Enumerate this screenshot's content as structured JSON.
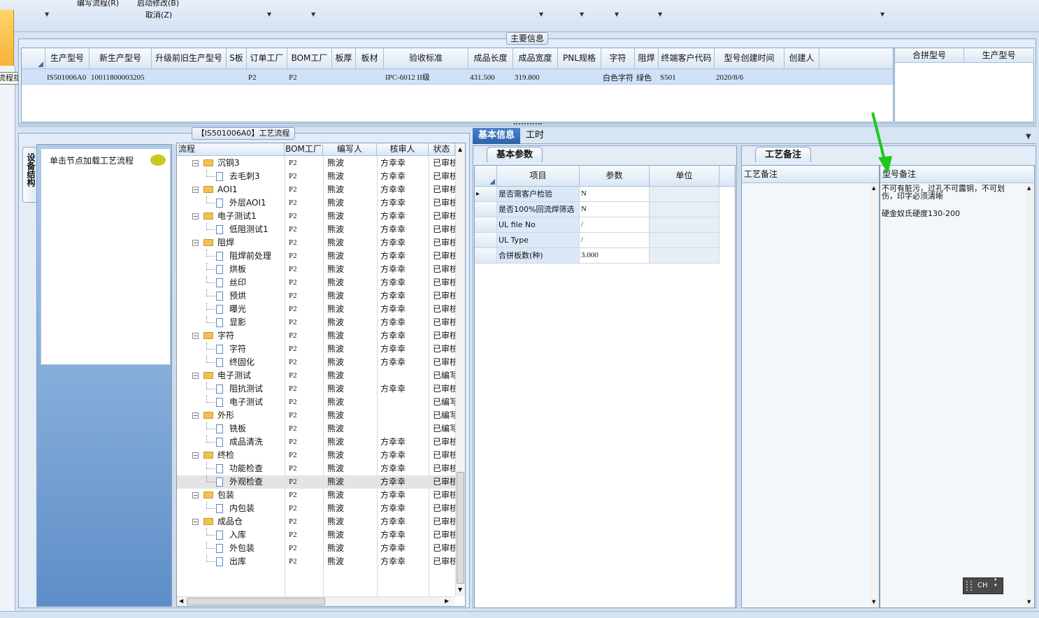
{
  "menu": {
    "item1": "编写流程(R)",
    "item2": "启动修改(B)",
    "item3": "取消(Z)"
  },
  "left_tooltip": "流程指示",
  "main_info": {
    "title": "主要信息",
    "columns": [
      "生产型号",
      "新生产型号",
      "升级前旧生产型号",
      "S板",
      "订单工厂",
      "BOM工厂",
      "板厚",
      "板材",
      "验收标准",
      "成品长度",
      "成品宽度",
      "PNL规格",
      "字符",
      "阻焊",
      "终端客户代码",
      "型号创建时间",
      "创建人"
    ],
    "row": [
      "IS501006A0",
      "10011800003205",
      "",
      "",
      "P2",
      "P2",
      "",
      "",
      "IPC-6012 II级",
      "431.500",
      "319.800",
      "",
      "白色字符",
      "绿色",
      "S501",
      "2020/8/6",
      ""
    ],
    "side_columns": [
      "合拼型号",
      "生产型号"
    ]
  },
  "side_tab": "设备结构",
  "node_hint": "单击节点加载工艺流程",
  "process": {
    "title": "【IS501006A0】工艺流程",
    "columns": [
      "流程",
      "BOM工厂",
      "编写人",
      "核审人",
      "状态"
    ],
    "rows": [
      {
        "level": 0,
        "type": "folder",
        "name": "沉铜3",
        "bom": "P2",
        "writer": "熊波",
        "reviewer": "方幸幸",
        "status": "已审核"
      },
      {
        "level": 1,
        "type": "doc",
        "name": "去毛刺3",
        "bom": "P2",
        "writer": "熊波",
        "reviewer": "方幸幸",
        "status": "已审核"
      },
      {
        "level": 0,
        "type": "folder",
        "name": "AOI1",
        "bom": "P2",
        "writer": "熊波",
        "reviewer": "方幸幸",
        "status": "已审核"
      },
      {
        "level": 1,
        "type": "doc",
        "name": "外层AOI1",
        "bom": "P2",
        "writer": "熊波",
        "reviewer": "方幸幸",
        "status": "已审核"
      },
      {
        "level": 0,
        "type": "folder",
        "name": "电子测试1",
        "bom": "P2",
        "writer": "熊波",
        "reviewer": "方幸幸",
        "status": "已审核"
      },
      {
        "level": 1,
        "type": "doc",
        "name": "低阻测试1",
        "bom": "P2",
        "writer": "熊波",
        "reviewer": "方幸幸",
        "status": "已审核"
      },
      {
        "level": 0,
        "type": "folder",
        "name": "阻焊",
        "bom": "P2",
        "writer": "熊波",
        "reviewer": "方幸幸",
        "status": "已审核"
      },
      {
        "level": 1,
        "type": "doc",
        "name": "阻焊前处理",
        "bom": "P2",
        "writer": "熊波",
        "reviewer": "方幸幸",
        "status": "已审核"
      },
      {
        "level": 1,
        "type": "doc",
        "name": "烘板",
        "bom": "P2",
        "writer": "熊波",
        "reviewer": "方幸幸",
        "status": "已审核"
      },
      {
        "level": 1,
        "type": "doc",
        "name": "丝印",
        "bom": "P2",
        "writer": "熊波",
        "reviewer": "方幸幸",
        "status": "已审核"
      },
      {
        "level": 1,
        "type": "doc",
        "name": "预烘",
        "bom": "P2",
        "writer": "熊波",
        "reviewer": "方幸幸",
        "status": "已审核"
      },
      {
        "level": 1,
        "type": "doc",
        "name": "曝光",
        "bom": "P2",
        "writer": "熊波",
        "reviewer": "方幸幸",
        "status": "已审核"
      },
      {
        "level": 1,
        "type": "doc",
        "name": "显影",
        "bom": "P2",
        "writer": "熊波",
        "reviewer": "方幸幸",
        "status": "已审核"
      },
      {
        "level": 0,
        "type": "folder",
        "name": "字符",
        "bom": "P2",
        "writer": "熊波",
        "reviewer": "方幸幸",
        "status": "已审核"
      },
      {
        "level": 1,
        "type": "doc",
        "name": "字符",
        "bom": "P2",
        "writer": "熊波",
        "reviewer": "方幸幸",
        "status": "已审核"
      },
      {
        "level": 1,
        "type": "doc",
        "name": "终固化",
        "bom": "P2",
        "writer": "熊波",
        "reviewer": "方幸幸",
        "status": "已审核"
      },
      {
        "level": 0,
        "type": "folder",
        "name": "电子测试",
        "bom": "P2",
        "writer": "熊波",
        "reviewer": "",
        "status": "已编写"
      },
      {
        "level": 1,
        "type": "doc",
        "name": "阻抗测试",
        "bom": "P2",
        "writer": "熊波",
        "reviewer": "方幸幸",
        "status": "已审核"
      },
      {
        "level": 1,
        "type": "doc",
        "name": "电子测试",
        "bom": "P2",
        "writer": "熊波",
        "reviewer": "",
        "status": "已编写"
      },
      {
        "level": 0,
        "type": "folder",
        "name": "外形",
        "bom": "P2",
        "writer": "熊波",
        "reviewer": "",
        "status": "已编写"
      },
      {
        "level": 1,
        "type": "doc",
        "name": "铣板",
        "bom": "P2",
        "writer": "熊波",
        "reviewer": "",
        "status": "已编写"
      },
      {
        "level": 1,
        "type": "doc",
        "name": "成品清洗",
        "bom": "P2",
        "writer": "熊波",
        "reviewer": "方幸幸",
        "status": "已审核"
      },
      {
        "level": 0,
        "type": "folder",
        "name": "终检",
        "bom": "P2",
        "writer": "熊波",
        "reviewer": "方幸幸",
        "status": "已审核"
      },
      {
        "level": 1,
        "type": "doc",
        "name": "功能检查",
        "bom": "P2",
        "writer": "熊波",
        "reviewer": "方幸幸",
        "status": "已审核"
      },
      {
        "level": 1,
        "type": "doc",
        "name": "外观检查",
        "bom": "P2",
        "writer": "熊波",
        "reviewer": "方幸幸",
        "status": "已审核"
      },
      {
        "level": 0,
        "type": "folder",
        "name": "包装",
        "bom": "P2",
        "writer": "熊波",
        "reviewer": "方幸幸",
        "status": "已审核"
      },
      {
        "level": 1,
        "type": "doc",
        "name": "内包装",
        "bom": "P2",
        "writer": "熊波",
        "reviewer": "方幸幸",
        "status": "已审核"
      },
      {
        "level": 0,
        "type": "folder",
        "name": "成品仓",
        "bom": "P2",
        "writer": "熊波",
        "reviewer": "方幸幸",
        "status": "已审核"
      },
      {
        "level": 1,
        "type": "doc",
        "name": "入库",
        "bom": "P2",
        "writer": "熊波",
        "reviewer": "方幸幸",
        "status": "已审核"
      },
      {
        "level": 1,
        "type": "doc",
        "name": "外包装",
        "bom": "P2",
        "writer": "熊波",
        "reviewer": "方幸幸",
        "status": "已审核"
      },
      {
        "level": 1,
        "type": "doc",
        "name": "出库",
        "bom": "P2",
        "writer": "熊波",
        "reviewer": "方幸幸",
        "status": "已审核"
      }
    ]
  },
  "tabs": {
    "basic": "基本信息",
    "labor": "工时"
  },
  "basic_params": {
    "title": "基本参数",
    "columns": [
      "项目",
      "参数",
      "单位"
    ],
    "rows": [
      {
        "item": "是否需客户检验",
        "value": "N",
        "unit": ""
      },
      {
        "item": "是否100%回流焊筛选",
        "value": "N",
        "unit": ""
      },
      {
        "item": "UL file No",
        "value": "/",
        "unit": ""
      },
      {
        "item": "UL Type",
        "value": "/",
        "unit": ""
      },
      {
        "item": "合拼板数(种)",
        "value": "3.000",
        "unit": ""
      }
    ]
  },
  "remarks": {
    "title": "工艺备注",
    "col1": "工艺备注",
    "col2": "型号备注",
    "model_note_line1": "不可有脏污，过孔不可露铜，不可划伤，印字必须清晰",
    "model_note_line2": "硬金奴氏硬度130-200"
  },
  "ime": "CH",
  "colors": {
    "accent_green": "#1ec81e",
    "selected_row": "#cfe2f8",
    "header_blue": "#dbe7f5"
  }
}
